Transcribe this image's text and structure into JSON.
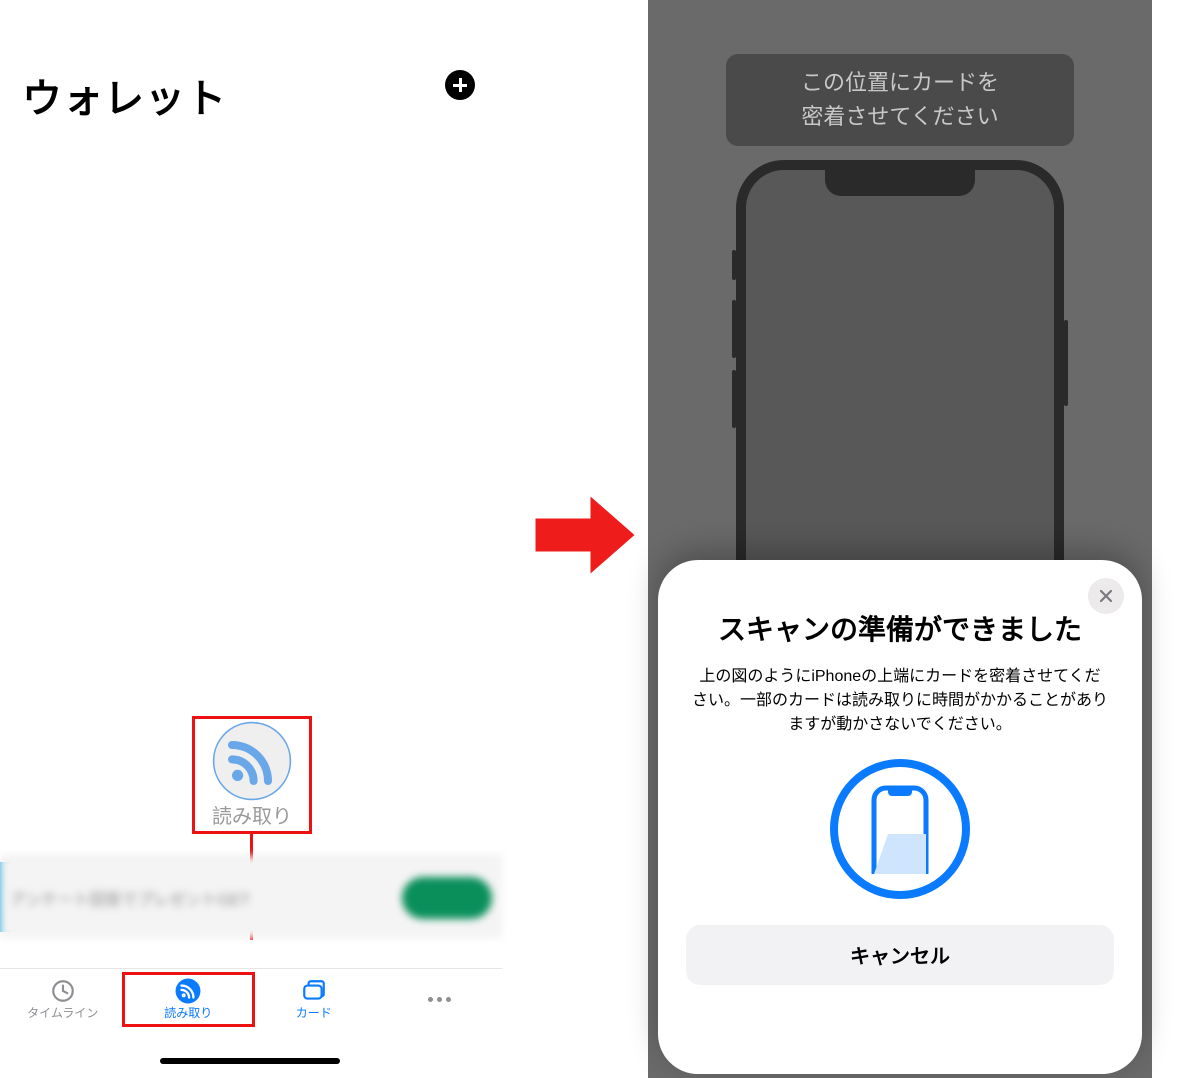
{
  "left": {
    "title": "ウォレット",
    "readButton": {
      "label": "読み取り"
    },
    "tabs": [
      {
        "label": "タイムライン"
      },
      {
        "label": "読み取り"
      },
      {
        "label": "カード"
      },
      {
        "label": ""
      }
    ]
  },
  "right": {
    "cardHint": {
      "line1": "この位置にカードを",
      "line2": "密着させてください"
    },
    "sheet": {
      "title": "スキャンの準備ができました",
      "body": "上の図のようにiPhoneの上端にカードを密着させてください。一部のカードは読み取りに時間がかかることがありますが動かさないでください。",
      "cancel": "キャンセル"
    }
  }
}
